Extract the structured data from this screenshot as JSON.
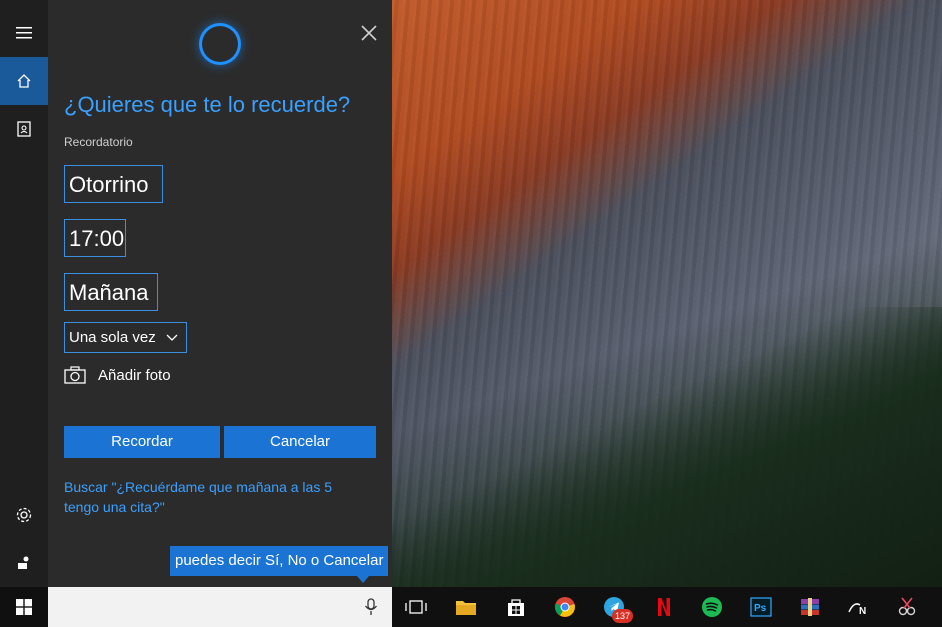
{
  "cortana": {
    "question": "¿Quieres que te lo recuerde?",
    "reminder_label": "Recordatorio",
    "title_value": "Otorrino",
    "time_value": "17:00",
    "day_value": "Mañana",
    "repeat_value": "Una sola vez",
    "add_photo": "Añadir foto",
    "remind_button": "Recordar",
    "cancel_button": "Cancelar",
    "search_hint": "Buscar \"¿Recuérdame que mañana a las 5 tengo una cita?\"",
    "tooltip": "puedes decir Sí, No o Cancelar"
  },
  "rail": {
    "items": [
      "menu-icon",
      "home-icon",
      "notebook-icon",
      "settings-icon",
      "feedback-icon"
    ]
  },
  "taskbar": {
    "telegram_badge": "137",
    "apps": [
      "task-view-icon",
      "file-explorer-icon",
      "store-icon",
      "chrome-icon",
      "telegram-icon",
      "netflix-icon",
      "spotify-icon",
      "photoshop-icon",
      "winrar-icon",
      "notion-icon",
      "snip-icon"
    ]
  },
  "colors": {
    "accent": "#1b74d4",
    "link": "#3aa0ff",
    "panel_bg": "#2b2b2b"
  }
}
